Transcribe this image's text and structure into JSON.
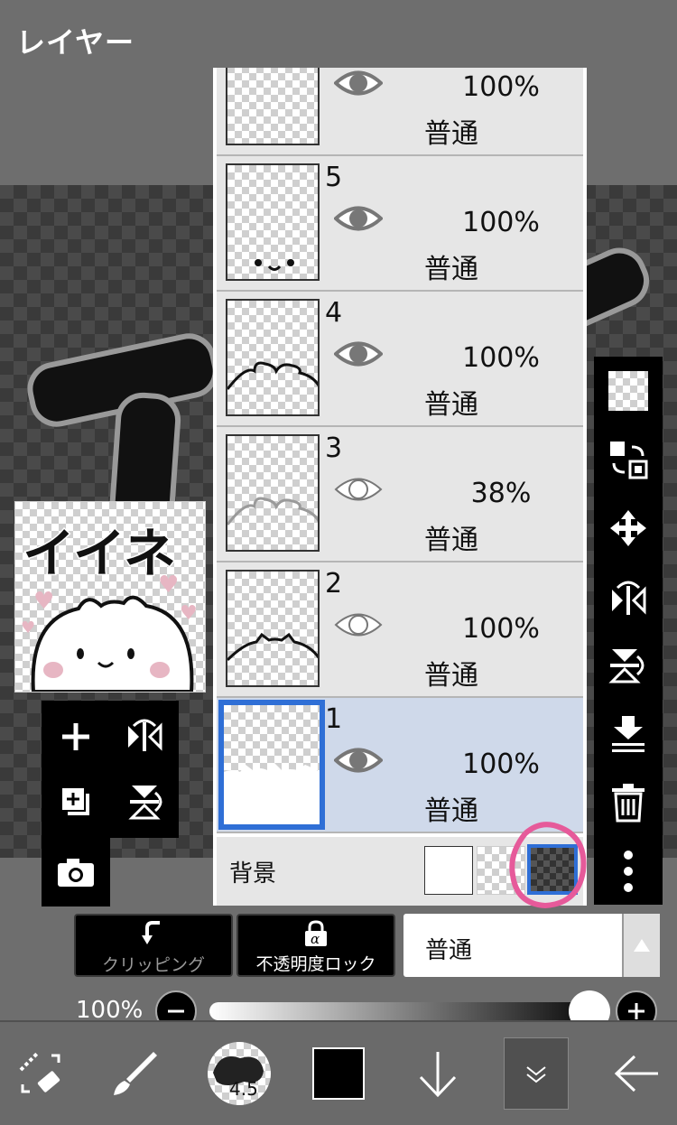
{
  "header": {
    "title": "レイヤー"
  },
  "thumbnail": {
    "text": "イイネ"
  },
  "layers": [
    {
      "number": "",
      "opacity": "100%",
      "mode": "普通",
      "visible": true,
      "selected": false
    },
    {
      "number": "5",
      "opacity": "100%",
      "mode": "普通",
      "visible": true,
      "selected": false
    },
    {
      "number": "4",
      "opacity": "100%",
      "mode": "普通",
      "visible": true,
      "selected": false
    },
    {
      "number": "3",
      "opacity": "38%",
      "mode": "普通",
      "visible": false,
      "selected": false
    },
    {
      "number": "2",
      "opacity": "100%",
      "mode": "普通",
      "visible": false,
      "selected": false
    },
    {
      "number": "1",
      "opacity": "100%",
      "mode": "普通",
      "visible": true,
      "selected": true
    }
  ],
  "background": {
    "label": "背景",
    "options": [
      "white",
      "checker",
      "dark-checker"
    ],
    "selected": "dark-checker"
  },
  "bottom_controls": {
    "clipping_label": "クリッピング",
    "alpha_lock_label": "不透明度ロック",
    "blend_mode": "普通",
    "opacity_label": "100%",
    "opacity_value": 1.0
  },
  "toolbar": {
    "brush_size": "4.5"
  },
  "colors": {
    "selected_border": "#2f6fd6",
    "selected_bg": "#cfd9ea",
    "annotation": "#e65a9a",
    "current_color": "#000000"
  }
}
